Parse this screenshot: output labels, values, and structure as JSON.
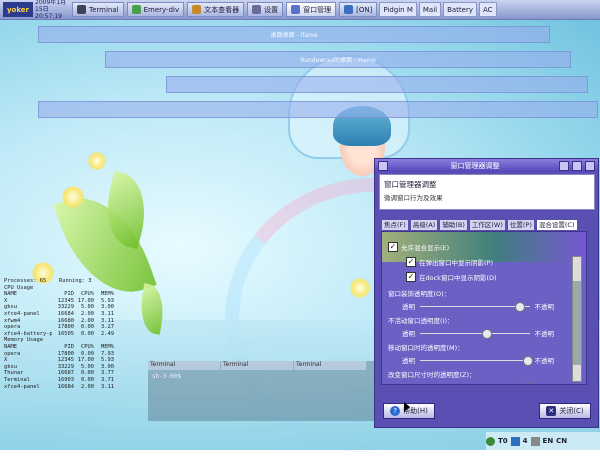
{
  "topbar": {
    "logo": "yoker",
    "clock": [
      "2009年1月15日",
      "20:57:19"
    ],
    "tasks": [
      {
        "label": "Terminal",
        "icon": "terminal-icon",
        "color": "#3a4455",
        "active": false
      },
      {
        "label": "Emery-div",
        "icon": "app-icon",
        "color": "#49a04a",
        "active": false
      },
      {
        "label": "文本查看器",
        "icon": "text-viewer-icon",
        "color": "#c7882a",
        "active": false
      },
      {
        "label": "设置",
        "icon": "settings-icon",
        "color": "#6b6b9b",
        "active": false
      },
      {
        "label": "窗口管理",
        "icon": "window-manager-icon",
        "color": "#5b70c8",
        "active": true
      },
      {
        "label": "[ON]",
        "icon": "status-icon",
        "color": "#3b6fc0",
        "active": false
      }
    ],
    "system": [
      "Pidgin M",
      "Mail",
      "Battery",
      "AC"
    ]
  },
  "bars": [
    "桌面桌面 - Ifame",
    "Rundewrad的桌面 - Hame"
  ],
  "conky": {
    "header": [
      "Processes: 65",
      "Running: 3"
    ],
    "cpu_title": "CPU Usage",
    "cpu_cols": [
      "NAME",
      "PID",
      "CPU%",
      "MEM%"
    ],
    "cpu_rows": [
      [
        "X",
        "12345",
        "17.00",
        "5.93"
      ],
      [
        "gksu",
        "33229",
        "5.00",
        "3.00"
      ],
      [
        "xfce4-panel",
        "16684",
        "2.00",
        "3.11"
      ],
      [
        "xfwm4",
        "16680",
        "2.00",
        "3.11"
      ],
      [
        "opera",
        "17800",
        "0.00",
        "3.27"
      ],
      [
        "xfce4-battery-p",
        "16505",
        "0.00",
        "2.49"
      ]
    ],
    "mem_title": "Memory Usage",
    "mem_cols": [
      "NAME",
      "PID",
      "CPU%",
      "MEM%"
    ],
    "mem_rows": [
      [
        "opera",
        "17800",
        "0.00",
        "7.93"
      ],
      [
        "X",
        "12345",
        "17.00",
        "5.93"
      ],
      [
        "gksu",
        "33229",
        "5.00",
        "3.00"
      ],
      [
        "Thunar",
        "16687",
        "0.00",
        "3.77"
      ],
      [
        "Terminal",
        "16903",
        "0.00",
        "3.71"
      ],
      [
        "xfce4-panel",
        "16684",
        "2.00",
        "3.11"
      ]
    ]
  },
  "terminal": {
    "tabs": [
      "Terminal",
      "Terminal",
      "Terminal"
    ],
    "prompt": "sh-3.00$"
  },
  "dialog": {
    "title": "窗口管理器调整",
    "heading": "窗口管理器调整",
    "subheading": "微调窗口行为及效果",
    "tabs": [
      "焦点(F)",
      "高级(A)",
      "辅助(B)",
      "工作区(W)",
      "位置(P)",
      "混合设置(C)"
    ],
    "active_tab": 5,
    "enable_compositing": "允许混合显示(E)",
    "shadow_popups": "在弹出窗口中显示阴影(P)",
    "shadow_dock": "在dock窗口中显示阴影(D)",
    "sliders": [
      {
        "label": "窗口装饰透明度(O)：",
        "value": 0.9
      },
      {
        "label": "不活动窗口透明度(I)：",
        "value": 0.6
      },
      {
        "label": "移动窗口时的透明度(M)：",
        "value": 0.97
      },
      {
        "label": "改变窗口尺寸时的透明度(Z)：",
        "value": 0.97
      }
    ],
    "slider_left": "透明",
    "slider_right": "不透明",
    "help": "帮助(H)",
    "close": "关闭(C)"
  },
  "tray": [
    "T0",
    "4",
    "EN",
    "CN"
  ]
}
